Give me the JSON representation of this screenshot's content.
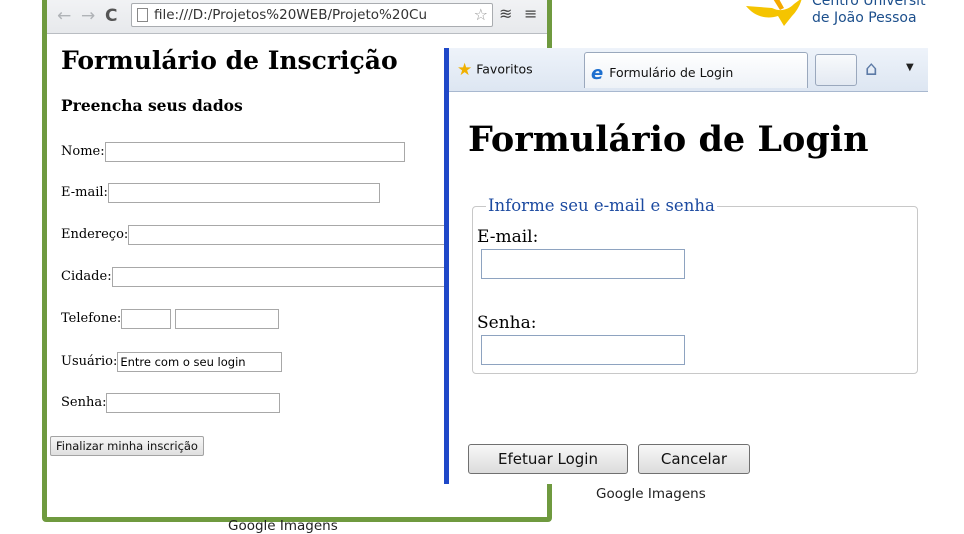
{
  "logo": {
    "line1": "Centro Universit",
    "line2": "de João Pessoa",
    "icon": "unipe-logo-icon"
  },
  "chrome": {
    "address": "file:///D:/Projetos%20WEB/Projeto%20Cu",
    "icons": [
      "back-arrow-icon",
      "forward-arrow-icon",
      "reload-icon",
      "page-icon",
      "star-icon",
      "extension-icon",
      "menu-icon"
    ]
  },
  "inscricao": {
    "title": "Formulário de Inscrição",
    "subtitle": "Preencha seus dados",
    "fields": {
      "nome": "Nome:",
      "email": "E-mail:",
      "endereco": "Endereço:",
      "cidade": "Cidade:",
      "telefone": "Telefone:",
      "usuario": "Usuário:",
      "senha": "Senha:"
    },
    "usuario_value": "Entre com o seu login",
    "submit": "Finalizar minha inscrição"
  },
  "caption_left": "Google Imagens",
  "caption_right": "Google Imagens",
  "ie": {
    "favorites": "Favoritos",
    "tab_title": "Formulário de Login",
    "icons": [
      "favorites-star-icon",
      "ie-logo-icon",
      "home-icon",
      "dropdown-arrow-icon"
    ]
  },
  "login": {
    "title": "Formulário de Login",
    "legend": "Informe seu e-mail e senha",
    "email_label": "E-mail:",
    "senha_label": "Senha:",
    "btn_login": "Efetuar Login",
    "btn_cancel": "Cancelar"
  }
}
